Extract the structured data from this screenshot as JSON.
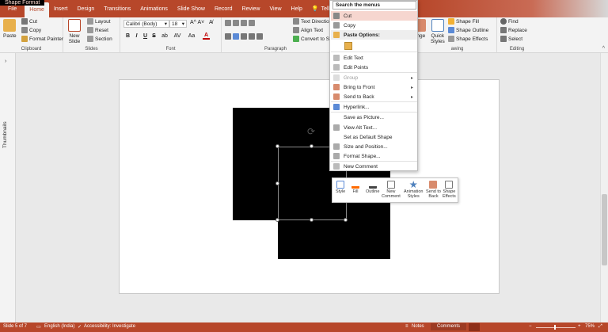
{
  "tabs": [
    "File",
    "Home",
    "Insert",
    "Design",
    "Transitions",
    "Animations",
    "Slide Show",
    "Record",
    "Review",
    "View",
    "Help",
    "Shape Format"
  ],
  "tell_me": "Tell",
  "ribbon": {
    "clipboard": {
      "paste": "Paste",
      "cut": "Cut",
      "copy": "Copy",
      "format_painter": "Format Painter",
      "label": "Clipboard"
    },
    "slides": {
      "new_slide": "New\nSlide",
      "layout": "Layout",
      "reset": "Reset",
      "section": "Section",
      "label": "Slides"
    },
    "font": {
      "family": "Calibri (Body)",
      "size": "18",
      "label": "Font",
      "bold": "B",
      "italic": "I",
      "underline": "U",
      "strike": "S",
      "shadow": "ab",
      "spacing": "AV",
      "case": "Aa"
    },
    "paragraph": {
      "text_direction": "Text Direction",
      "align_text": "Align Text",
      "convert": "Convert to Sm",
      "label": "Paragraph"
    },
    "drawing": {
      "arrange": "ange",
      "quick_styles": "Quick\nStyles",
      "shape_fill": "Shape Fill",
      "shape_outline": "Shape Outline",
      "shape_effects": "Shape Effects",
      "label": "awing"
    },
    "editing": {
      "find": "Find",
      "replace": "Replace",
      "select": "Select",
      "label": "Editing"
    }
  },
  "thumbnails_label": "Thumbnails",
  "context_menu": {
    "search": "Search the menus",
    "items": [
      {
        "label": "Cut",
        "state": "highlighted"
      },
      {
        "label": "Copy",
        "state": "normal"
      },
      {
        "label": "Paste Options:",
        "state": "header"
      },
      {
        "label": "Edit Text",
        "state": "normal"
      },
      {
        "label": "Edit Points",
        "state": "normal"
      },
      {
        "label": "Group",
        "state": "disabled"
      },
      {
        "label": "Bring to Front",
        "state": "normal"
      },
      {
        "label": "Send to Back",
        "state": "normal"
      },
      {
        "label": "Hyperlink...",
        "state": "normal"
      },
      {
        "label": "Save as Picture...",
        "state": "normal"
      },
      {
        "label": "View Alt Text...",
        "state": "normal"
      },
      {
        "label": "Set as Default Shape",
        "state": "normal"
      },
      {
        "label": "Size and Position...",
        "state": "normal"
      },
      {
        "label": "Format Shape...",
        "state": "normal"
      },
      {
        "label": "New Comment",
        "state": "normal"
      }
    ]
  },
  "mini_toolbar": [
    {
      "label": "Style"
    },
    {
      "label": "Fill"
    },
    {
      "label": "Outline"
    },
    {
      "label": "New\nComment"
    },
    {
      "label": "Animation\nStyles"
    },
    {
      "label": "Send to\nBack"
    },
    {
      "label": "Shape\nEffects"
    }
  ],
  "status": {
    "slide": "Slide 5 of 7",
    "language": "English (India)",
    "accessibility": "Accessibility: Investigate",
    "notes": "Notes",
    "comments": "Comments",
    "zoom": "75%"
  },
  "colors": {
    "accent": "#b7472a",
    "highlight": "#f6d6cf",
    "shape": "#000000"
  }
}
